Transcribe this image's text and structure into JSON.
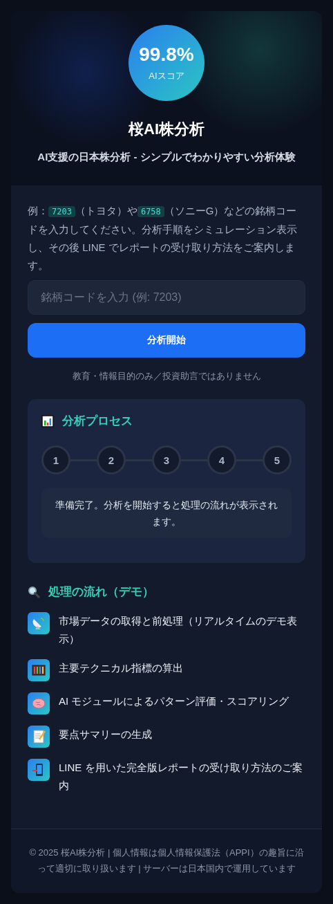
{
  "hero": {
    "score": "99.8%",
    "score_label": "AIスコア",
    "title": "桜AI株分析",
    "subtitle": "AI支援の日本株分析 - シンプルでわかりやすい分析体験"
  },
  "intro": [
    {
      "kind": "text",
      "text": "例："
    },
    {
      "kind": "code",
      "text": "7203"
    },
    {
      "kind": "text",
      "text": "（トヨタ）や"
    },
    {
      "kind": "code",
      "text": "6758"
    },
    {
      "kind": "text",
      "text": "（ソニーG）などの銘柄コードを入力してください。分析手順をシミュレーション表示し、その後 LINE でレポートの受け取り方法をご案内します。"
    }
  ],
  "search": {
    "placeholder": "銘柄コードを入力 (例: 7203)"
  },
  "start_button": "分析開始",
  "disclaimer": "教育・情報目的のみ／投資助言ではありません",
  "process": {
    "title": "分析プロセス",
    "steps": [
      "1",
      "2",
      "3",
      "4",
      "5"
    ],
    "status": "準備完了。分析を開始すると処理の流れが表示されます。"
  },
  "flow": {
    "title": "処理の流れ（デモ）",
    "items": [
      {
        "kind": "satellite",
        "text": "市場データの取得と前処理（リアルタイムのデモ表示）"
      },
      {
        "kind": "abacus",
        "text": "主要テクニカル指標の算出"
      },
      {
        "kind": "brain",
        "text": "AI モジュールによるパターン評価・スコアリング"
      },
      {
        "kind": "memo",
        "text": "要点サマリーの生成"
      },
      {
        "kind": "phone",
        "text": "LINE を用いた完全版レポートの受け取り方法のご案内"
      }
    ]
  },
  "footer": "© 2025 桜AI株分析 | 個人情報は個人情報保護法（APPI）の趣旨に沿って適切に取り扱います | サーバーは日本国内で運用しています"
}
